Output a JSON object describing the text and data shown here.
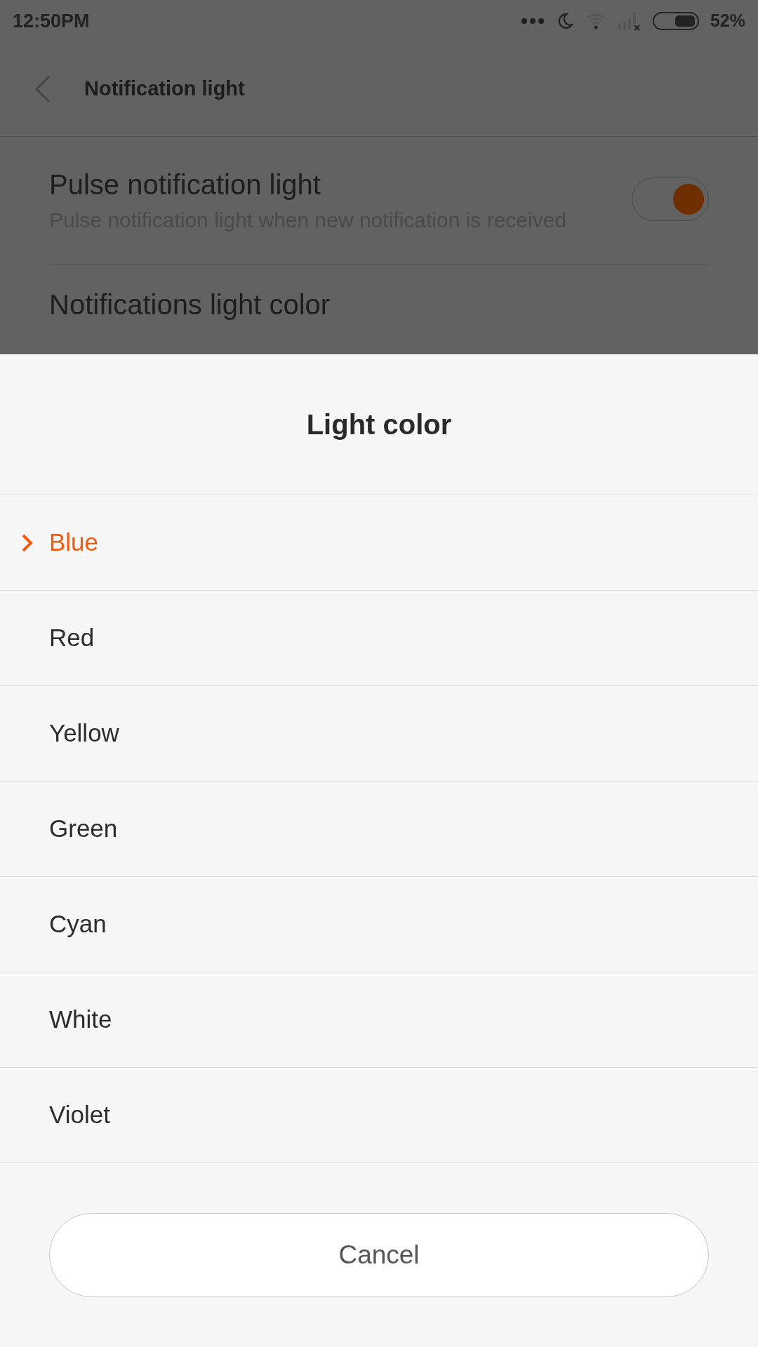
{
  "status_bar": {
    "time": "12:50PM",
    "battery": "52%"
  },
  "header": {
    "title": "Notification light"
  },
  "settings": [
    {
      "kind": "toggle",
      "title": "Pulse notification light",
      "subtitle": "Pulse notification light when new notification is received",
      "on": true
    },
    {
      "kind": "link",
      "title": "Notifications light color"
    }
  ],
  "dialog": {
    "title": "Light color",
    "options": [
      {
        "label": "Blue",
        "selected": true
      },
      {
        "label": "Red",
        "selected": false
      },
      {
        "label": "Yellow",
        "selected": false
      },
      {
        "label": "Green",
        "selected": false
      },
      {
        "label": "Cyan",
        "selected": false
      },
      {
        "label": "White",
        "selected": false
      },
      {
        "label": "Violet",
        "selected": false
      }
    ],
    "cancel": "Cancel"
  }
}
